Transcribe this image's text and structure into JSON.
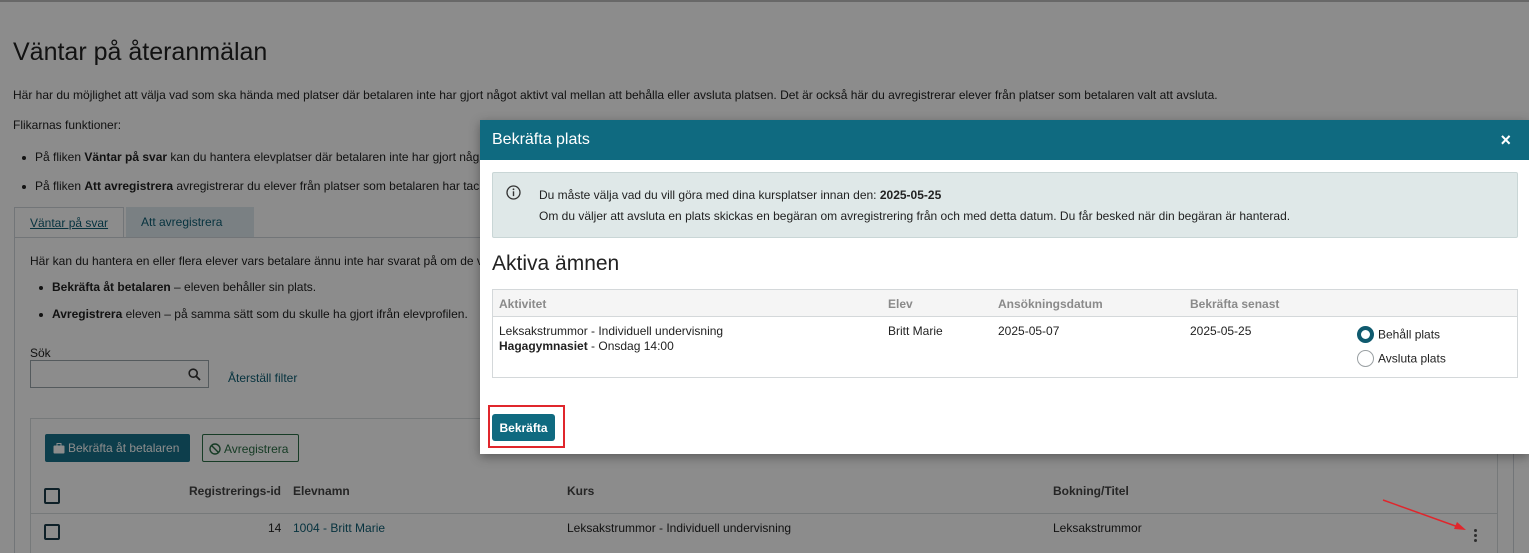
{
  "page": {
    "title": "Väntar på återanmälan",
    "intro": "Här har du möjlighet att välja vad som ska hända med platser där betalaren inte har gjort något aktivt val mellan att behålla eller avsluta platsen. Det är också här du avregistrerar elever från platser som betalaren valt att avsluta.",
    "functions_title": "Flikarnas funktioner:",
    "functions": [
      {
        "prefix": "På fliken ",
        "bold": "Väntar på svar",
        "rest": " kan du hantera elevplatser där betalaren inte har gjort någ"
      },
      {
        "prefix": "På fliken ",
        "bold": "Att avregistrera",
        "rest": " avregistrerar du elever från platser som betalaren har tac"
      }
    ]
  },
  "tabs": [
    {
      "label": "Väntar på svar",
      "active": true
    },
    {
      "label": "Att avregistrera",
      "active": false
    }
  ],
  "panel": {
    "intro": "Här kan du hantera en eller flera elever vars betalare ännu inte har svarat på om de v",
    "items": [
      {
        "bold": "Bekräfta åt betalaren",
        "rest": " – eleven behåller sin plats."
      },
      {
        "bold": "Avregistrera",
        "rest": " eleven – på samma sätt som du skulle ha gjort ifrån elevprofilen."
      }
    ],
    "search_label": "Sök",
    "search_value": "",
    "reset_link": "Återställ filter",
    "confirm_payer_button": "Bekräfta åt betalaren",
    "unregister_button": "Avregistrera"
  },
  "grid": {
    "headers": {
      "reg_id": "Registrerings-id",
      "student": "Elevnamn",
      "course": "Kurs",
      "booking": "Bokning/Titel"
    },
    "rows": [
      {
        "reg_id": "14",
        "student": "1004 - Britt Marie",
        "course": "Leksakstrummor - Individuell undervisning",
        "booking": "Leksakstrummor"
      }
    ]
  },
  "modal": {
    "title": "Bekräfta plats",
    "close_icon": "×",
    "alert": {
      "line1_prefix": "Du måste välja vad du vill göra med dina kursplatser innan den: ",
      "line1_date": "2025-05-25",
      "line2": "Om du väljer att avsluta en plats skickas en begäran om avregistrering från och med detta datum. Du får besked när din begäran är hanterad."
    },
    "section_title": "Aktiva ämnen",
    "table": {
      "headers": {
        "activity": "Aktivitet",
        "student": "Elev",
        "application_date": "Ansökningsdatum",
        "confirm_by": "Bekräfta senast"
      },
      "row": {
        "activity": "Leksakstrummor - Individuell undervisning",
        "school": "Hagagymnasiet",
        "schedule": " - Onsdag 14:00",
        "student": "Britt Marie",
        "application_date": "2025-05-07",
        "confirm_by": "2025-05-25",
        "option_keep": "Behåll plats",
        "option_end": "Avsluta plats",
        "selected": "keep"
      }
    },
    "confirm_button": "Bekräfta"
  },
  "colors": {
    "header": "#0f6a80",
    "primary_button": "#0f6a80",
    "highlight": "#e0262c",
    "alert_bg": "#dfe8e8"
  }
}
